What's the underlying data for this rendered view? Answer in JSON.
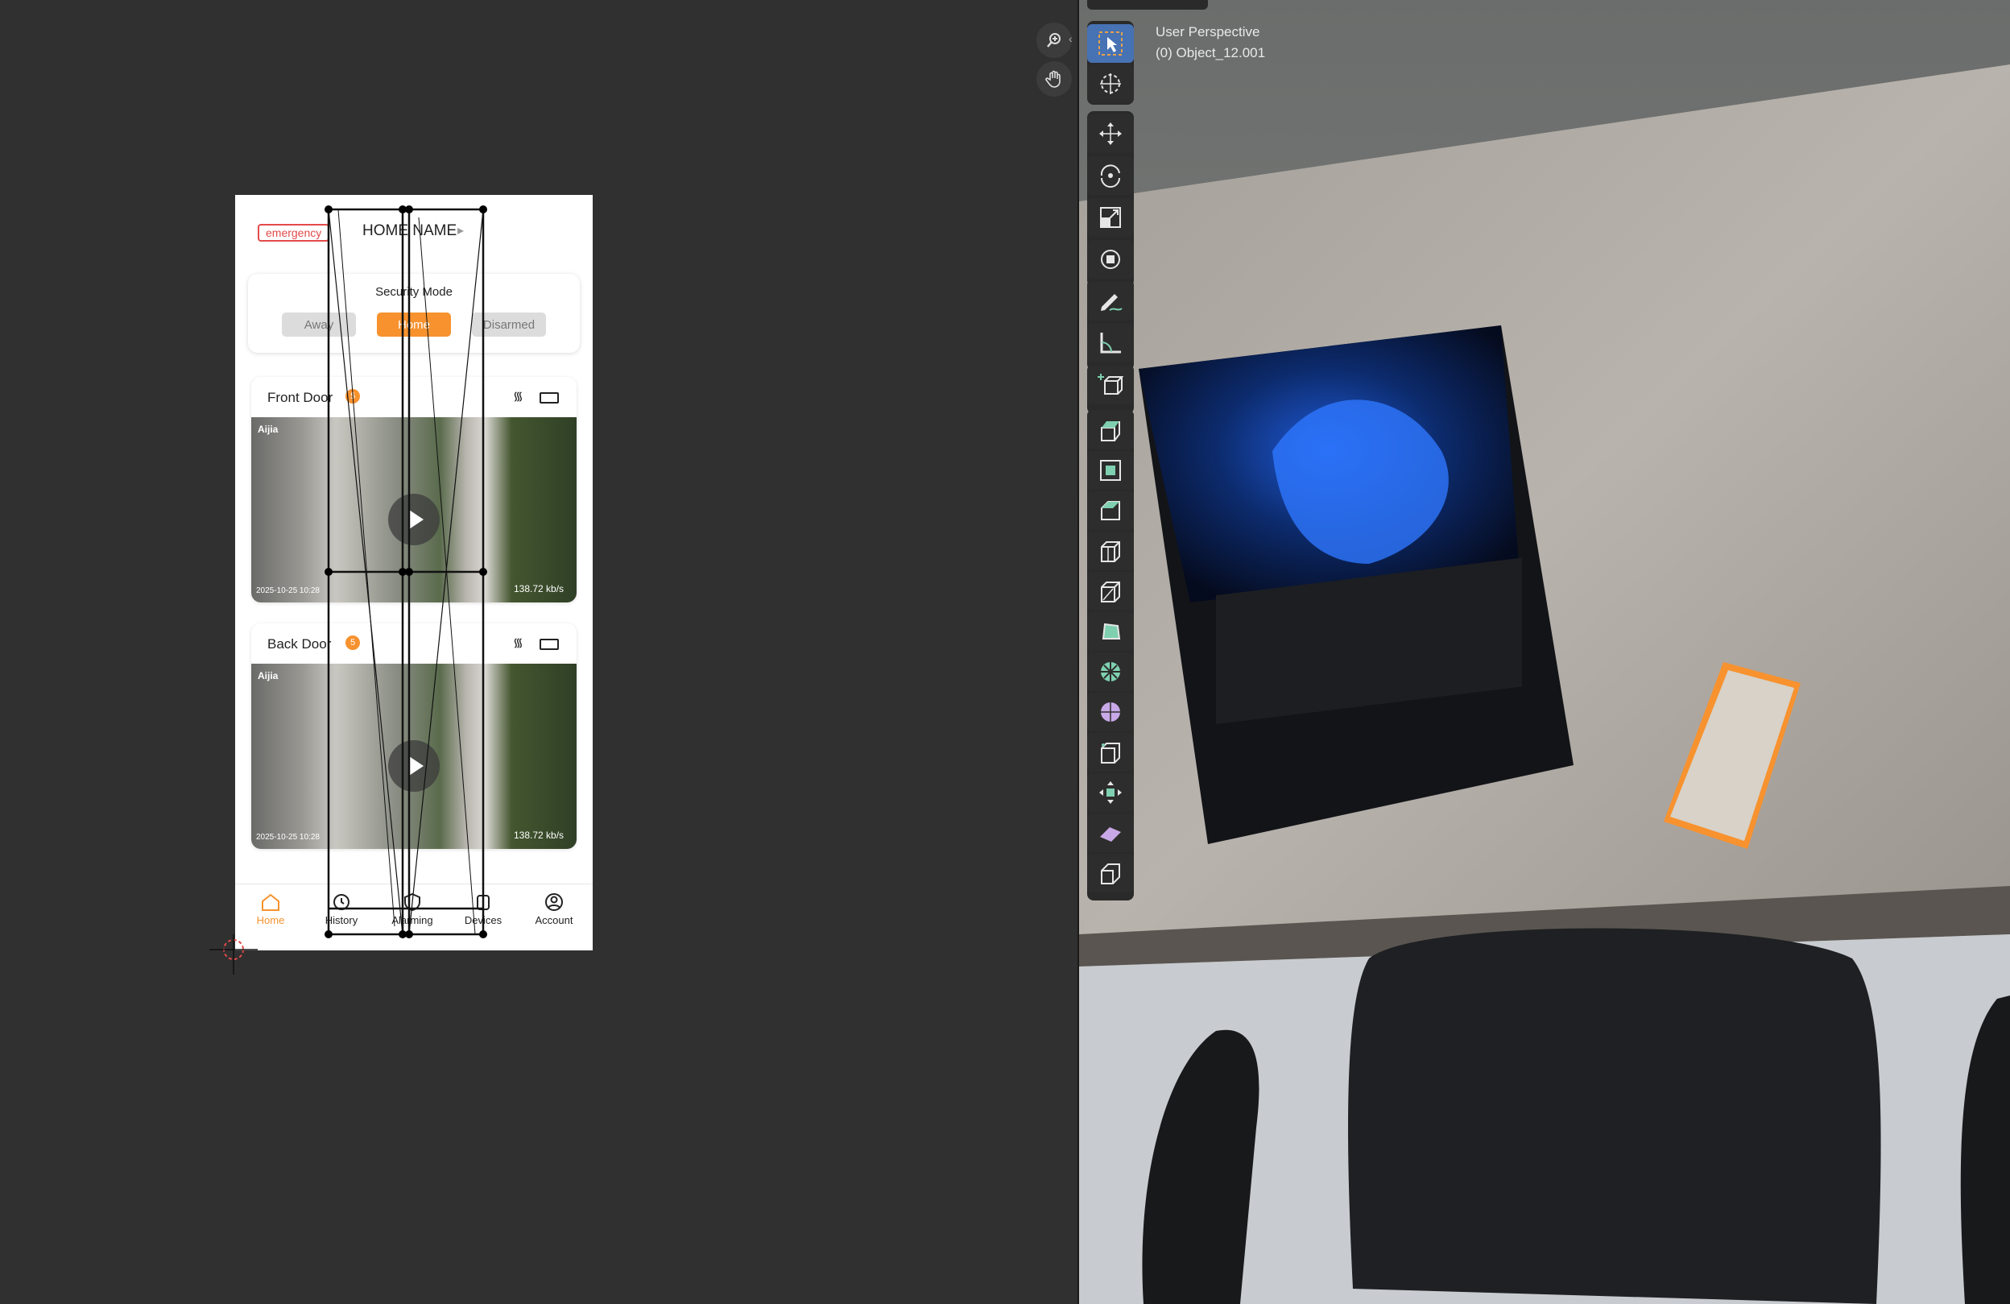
{
  "left_editor": {
    "phone": {
      "emergency_label": "emergency",
      "home_name": "HOME NAME",
      "security_mode": {
        "title": "Security Mode",
        "options": [
          "Away",
          "Home",
          "Disarmed"
        ],
        "selected": "Home"
      },
      "cameras": [
        {
          "name": "Front Door",
          "badge": "5",
          "timestamp": "2025-10-25 10:28",
          "speed": "138.72 kb/s",
          "brand": "Aijia"
        },
        {
          "name": "Back Door",
          "badge": "5",
          "timestamp": "2025-10-25 10:28",
          "speed": "138.72 kb/s",
          "brand": "Aijia"
        }
      ],
      "tabs": [
        {
          "label": "Home",
          "icon": "home-icon",
          "active": true
        },
        {
          "label": "History",
          "icon": "history-icon",
          "active": false
        },
        {
          "label": "Alarming",
          "icon": "shield-icon",
          "active": false
        },
        {
          "label": "Devices",
          "icon": "devices-icon",
          "active": false
        },
        {
          "label": "Account",
          "icon": "account-icon",
          "active": false
        }
      ]
    }
  },
  "viewport": {
    "perspective_label": "User Perspective",
    "object_label": "(0) Object_12.001"
  },
  "colors": {
    "accent_orange": "#f7922f",
    "emergency_red": "#e34a4a",
    "active_tool_blue": "#4772b3",
    "editor_bg": "#303030"
  }
}
